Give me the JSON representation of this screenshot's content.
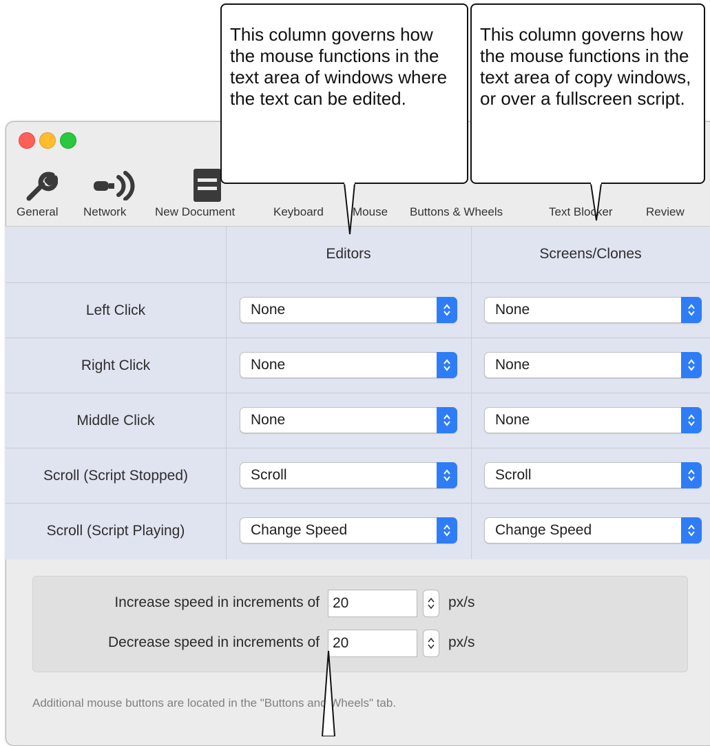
{
  "window": {
    "toolbar": [
      {
        "label": "General",
        "icon": "wrench-icon"
      },
      {
        "label": "Network",
        "icon": "network-plug-icon"
      },
      {
        "label": "New Document",
        "icon": "document-icon"
      },
      {
        "label": "Keyboard",
        "icon": "keyboard-icon"
      },
      {
        "label": "Mouse",
        "icon": "mouse-icon",
        "selected": true
      },
      {
        "label": "Buttons & Wheels",
        "icon": "buttons-wheels-icon"
      },
      {
        "label": "Text Blocker",
        "icon": "text-blocker-icon"
      },
      {
        "label": "Review",
        "icon": "star-icon"
      }
    ]
  },
  "grid": {
    "columns": [
      "Editors",
      "Screens/Clones"
    ],
    "rows": [
      {
        "label": "Left Click",
        "editors": "None",
        "screens": "None"
      },
      {
        "label": "Right Click",
        "editors": "None",
        "screens": "None"
      },
      {
        "label": "Middle Click",
        "editors": "None",
        "screens": "None"
      },
      {
        "label": "Scroll (Script Stopped)",
        "editors": "Scroll",
        "screens": "Scroll"
      },
      {
        "label": "Scroll (Script Playing)",
        "editors": "Change Speed",
        "screens": "Change Speed"
      }
    ]
  },
  "speed": {
    "increase_label": "Increase speed in increments of",
    "increase_value": "20",
    "decrease_label": "Decrease speed in increments of",
    "decrease_value": "20",
    "unit": "px/s"
  },
  "footnote": "Additional mouse buttons are located in the \"Buttons and Wheels\" tab.",
  "callouts": {
    "editors": "This column governs how the mouse functions in the text area of windows where the text can be edited.",
    "screens": "This column governs how the mouse functions in the text area of copy windows, or over a fullscreen script."
  },
  "colors": {
    "accent": "#2f7df6",
    "grid_bg": "#e0e4f1",
    "window_bg": "#ececec"
  }
}
